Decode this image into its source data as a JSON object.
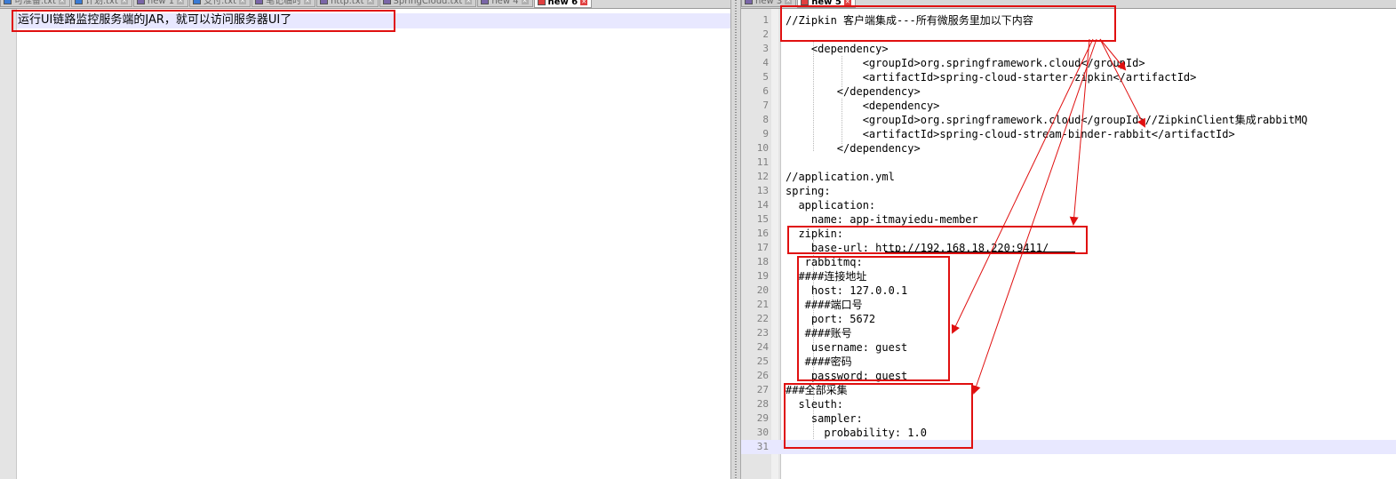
{
  "left_pane": {
    "tabs": [
      {
        "label": "可准备.txt",
        "icon": "notepad-file-icon",
        "icon_color": "blue"
      },
      {
        "label": "计划.txt",
        "icon": "notepad-file-icon",
        "icon_color": "blue"
      },
      {
        "label": "new 1",
        "icon": "notepad-file-icon",
        "icon_color": "purple"
      },
      {
        "label": "支付.txt",
        "icon": "notepad-file-icon",
        "icon_color": "blue"
      },
      {
        "label": "笔记临时",
        "icon": "notepad-file-icon",
        "icon_color": "purple"
      },
      {
        "label": "http.txt",
        "icon": "notepad-file-icon",
        "icon_color": "purple"
      },
      {
        "label": "SpringCloud.txt",
        "icon": "notepad-file-icon",
        "icon_color": "purple"
      },
      {
        "label": "new 4",
        "icon": "notepad-file-icon",
        "icon_color": "purple"
      },
      {
        "label": "new 6",
        "icon": "notepad-file-icon",
        "icon_color": "red",
        "active": true
      }
    ],
    "text": "运行UI链路监控服务端的JAR，就可以访问服务器UI了"
  },
  "right_pane": {
    "tabs": [
      {
        "label": "new 3",
        "icon": "notepad-file-icon",
        "icon_color": "purple"
      },
      {
        "label": "new 5",
        "icon": "notepad-file-icon",
        "icon_color": "red",
        "active": true
      }
    ],
    "lines": [
      {
        "n": "1",
        "text": "//Zipkin 客户端集成---所有微服务里加以下内容"
      },
      {
        "n": "2",
        "text": ""
      },
      {
        "n": "3",
        "text": "    <dependency>"
      },
      {
        "n": "4",
        "text": "            <groupId>org.springframework.cloud</groupId>"
      },
      {
        "n": "5",
        "text": "            <artifactId>spring-cloud-starter-zipkin</artifactId>"
      },
      {
        "n": "6",
        "text": "        </dependency>"
      },
      {
        "n": "7",
        "text": "            <dependency>"
      },
      {
        "n": "8",
        "text": "            <groupId>org.springframework.cloud</groupId>//ZipkinClient集成rabbitMQ"
      },
      {
        "n": "9",
        "text": "            <artifactId>spring-cloud-stream-binder-rabbit</artifactId>"
      },
      {
        "n": "10",
        "text": "        </dependency>"
      },
      {
        "n": "11",
        "text": ""
      },
      {
        "n": "12",
        "text": "//application.yml"
      },
      {
        "n": "13",
        "text": "spring:"
      },
      {
        "n": "14",
        "text": "  application:"
      },
      {
        "n": "15",
        "text": "    name: app-itmayiedu-member"
      },
      {
        "n": "16",
        "text": "  zipkin:"
      },
      {
        "n": "17",
        "text": "    base-url: http://192.168.18.220:9411/"
      },
      {
        "n": "18",
        "text": "   rabbitmq:"
      },
      {
        "n": "19",
        "text": "  ####连接地址"
      },
      {
        "n": "20",
        "text": "    host: 127.0.0.1"
      },
      {
        "n": "21",
        "text": "   ####端口号"
      },
      {
        "n": "22",
        "text": "    port: 5672"
      },
      {
        "n": "23",
        "text": "   ####账号"
      },
      {
        "n": "24",
        "text": "    username: guest"
      },
      {
        "n": "25",
        "text": "   ####密码"
      },
      {
        "n": "26",
        "text": "    password: guest"
      },
      {
        "n": "27",
        "text": "###全部采集"
      },
      {
        "n": "28",
        "text": "  sleuth:"
      },
      {
        "n": "29",
        "text": "    sampler:"
      },
      {
        "n": "30",
        "text": "      probability: 1.0"
      },
      {
        "n": "31",
        "text": ""
      }
    ]
  },
  "colors": {
    "annotation": "#e01010",
    "current_line": "#e8e8ff",
    "gutter": "#e4e4e4",
    "line_number": "#808080"
  }
}
